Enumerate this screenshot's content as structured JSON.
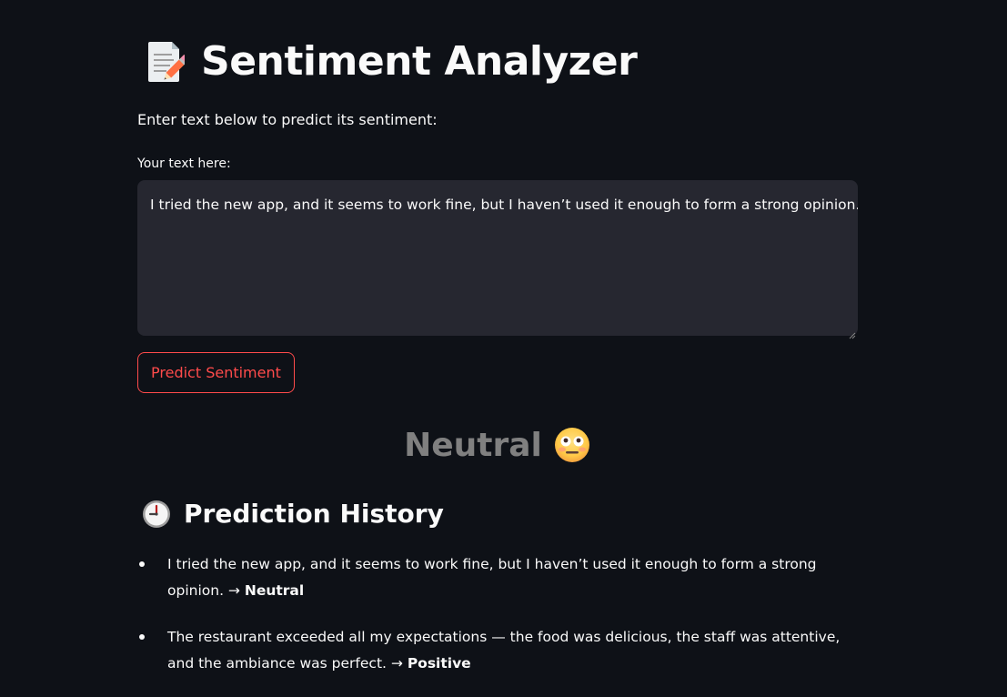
{
  "header": {
    "title": "Sentiment Analyzer",
    "title_icon": "memo-pencil-icon"
  },
  "intro_text": "Enter text below to predict its sentiment:",
  "input": {
    "label": "Your text here:",
    "value": "I tried the new app, and it seems to work fine, but I haven’t used it enough to form a strong opinion."
  },
  "predict_button": {
    "label": "Predict Sentiment"
  },
  "result": {
    "label": "Neutral",
    "icon": "neutral-face-emoji"
  },
  "history": {
    "title": "Prediction History",
    "icon": "clock-icon",
    "items": [
      {
        "text": "I tried the new app, and it seems to work fine, but I haven’t used it enough to form a strong opinion. →",
        "label": "Neutral"
      },
      {
        "text": "The restaurant exceeded all my expectations — the food was delicious, the staff was attentive, and the ambiance was perfect. →",
        "label": "Positive"
      }
    ]
  },
  "colors": {
    "background": "#0e1117",
    "input_background": "#262730",
    "accent": "#ff4b4b",
    "neutral": "#808080",
    "text": "#fafafa"
  }
}
